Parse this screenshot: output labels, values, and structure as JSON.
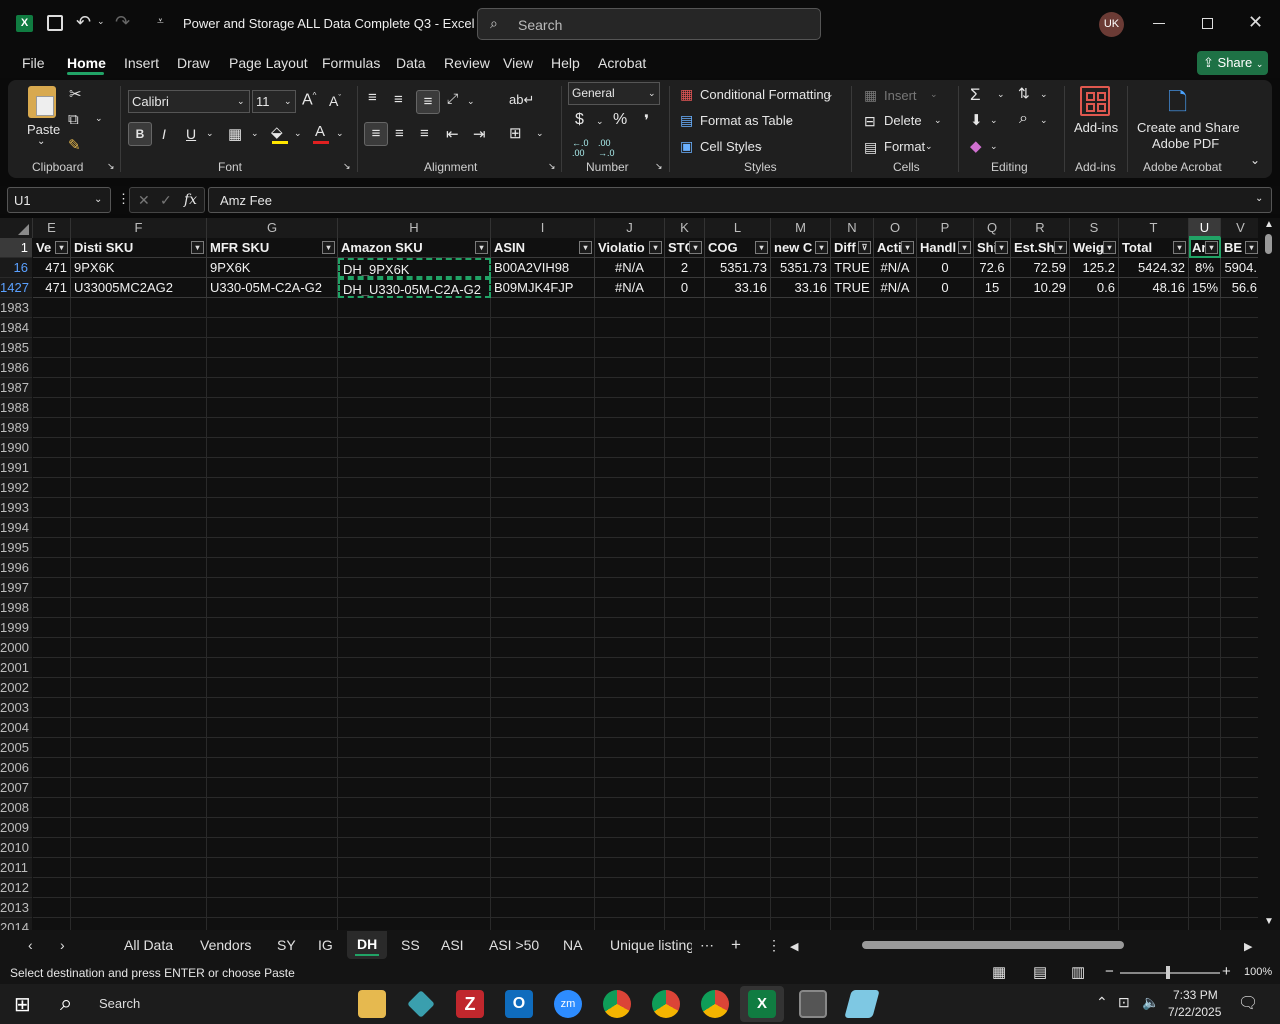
{
  "window": {
    "title": "Power and Storage ALL Data Complete Q3  -  Excel",
    "search_placeholder": "Search",
    "user_initials": "UK"
  },
  "menu": [
    "File",
    "Home",
    "Insert",
    "Draw",
    "Page Layout",
    "Formulas",
    "Data",
    "Review",
    "View",
    "Help",
    "Acrobat"
  ],
  "share_label": "Share",
  "ribbon": {
    "clipboard": {
      "paste": "Paste",
      "group": "Clipboard"
    },
    "font": {
      "name": "Calibri",
      "size": "11",
      "group": "Font",
      "bold": "B",
      "italic": "I",
      "underline": "U"
    },
    "alignment": {
      "group": "Alignment"
    },
    "number": {
      "format": "General",
      "group": "Number",
      "currency": "$",
      "percent": "%"
    },
    "styles": {
      "conditional": "Conditional Formatting",
      "format_table": "Format as Table",
      "cell_styles": "Cell Styles",
      "group": "Styles"
    },
    "cells": {
      "insert": "Insert",
      "delete": "Delete",
      "format": "Format",
      "group": "Cells"
    },
    "editing": {
      "group": "Editing"
    },
    "addins": {
      "label": "Add-ins",
      "group": "Add-ins"
    },
    "acrobat": {
      "label1": "Create and Share",
      "label2": "Adobe PDF",
      "group": "Adobe Acrobat"
    }
  },
  "formula_bar": {
    "name_box": "U1",
    "fx": "fx",
    "content": "Amz Fee"
  },
  "columns": [
    "E",
    "F",
    "G",
    "H",
    "I",
    "J",
    "K",
    "L",
    "M",
    "N",
    "O",
    "P",
    "Q",
    "R",
    "S",
    "T",
    "U",
    "V"
  ],
  "header_row": {
    "row": "1",
    "cells": [
      "Ve",
      "Disti SKU",
      "MFR SKU",
      "Amazon SKU",
      "ASIN",
      "Violatio",
      "STC",
      "COG",
      "new C",
      "Diff",
      "Acti",
      "Handl",
      "Shi",
      "Est.Shi",
      "Weig",
      "Total",
      "Ar",
      "BE"
    ]
  },
  "rows": [
    {
      "row": "16",
      "cells": [
        "471",
        "9PX6K",
        "9PX6K",
        "DH_9PX6K",
        "B00A2VIH98",
        "#N/A",
        "2",
        "5351.73",
        "5351.73",
        "TRUE",
        "#N/A",
        "0",
        "72.6",
        "72.59",
        "125.2",
        "5424.32",
        "8%",
        "5904."
      ]
    },
    {
      "row": "1427",
      "cells": [
        "471",
        "U33005MC2AG2",
        "U330-05M-C2A-G2",
        "DH_U330-05M-C2A-G2",
        "B09MJK4FJP",
        "#N/A",
        "0",
        "33.16",
        "33.16",
        "TRUE",
        "#N/A",
        "0",
        "15",
        "10.29",
        "0.6",
        "48.16",
        "15%",
        "56.6"
      ]
    }
  ],
  "empty_rows": [
    "1983",
    "1984",
    "1985",
    "1986",
    "1987",
    "1988",
    "1989",
    "1990",
    "1991",
    "1992",
    "1993",
    "1994",
    "1995",
    "1996",
    "1997",
    "1998",
    "1999",
    "2000",
    "2001",
    "2002",
    "2003",
    "2004",
    "2005",
    "2006",
    "2007",
    "2008",
    "2009",
    "2010",
    "2011",
    "2012",
    "2013",
    "2014"
  ],
  "sheet_tabs": [
    "All Data",
    "Vendors",
    "SY",
    "IG",
    "DH",
    "SS",
    "ASI",
    "ASI >50",
    "NA",
    "Unique listing"
  ],
  "active_tab": "DH",
  "status": {
    "message": "Select destination and press ENTER or choose Paste",
    "zoom": "100%"
  },
  "taskbar": {
    "search": "Search",
    "time": "7:33 PM",
    "date": "7/22/2025"
  },
  "colors": {
    "accent_green": "#1e7145",
    "excel_green": "#107c41",
    "selection_green": "#21a366"
  }
}
